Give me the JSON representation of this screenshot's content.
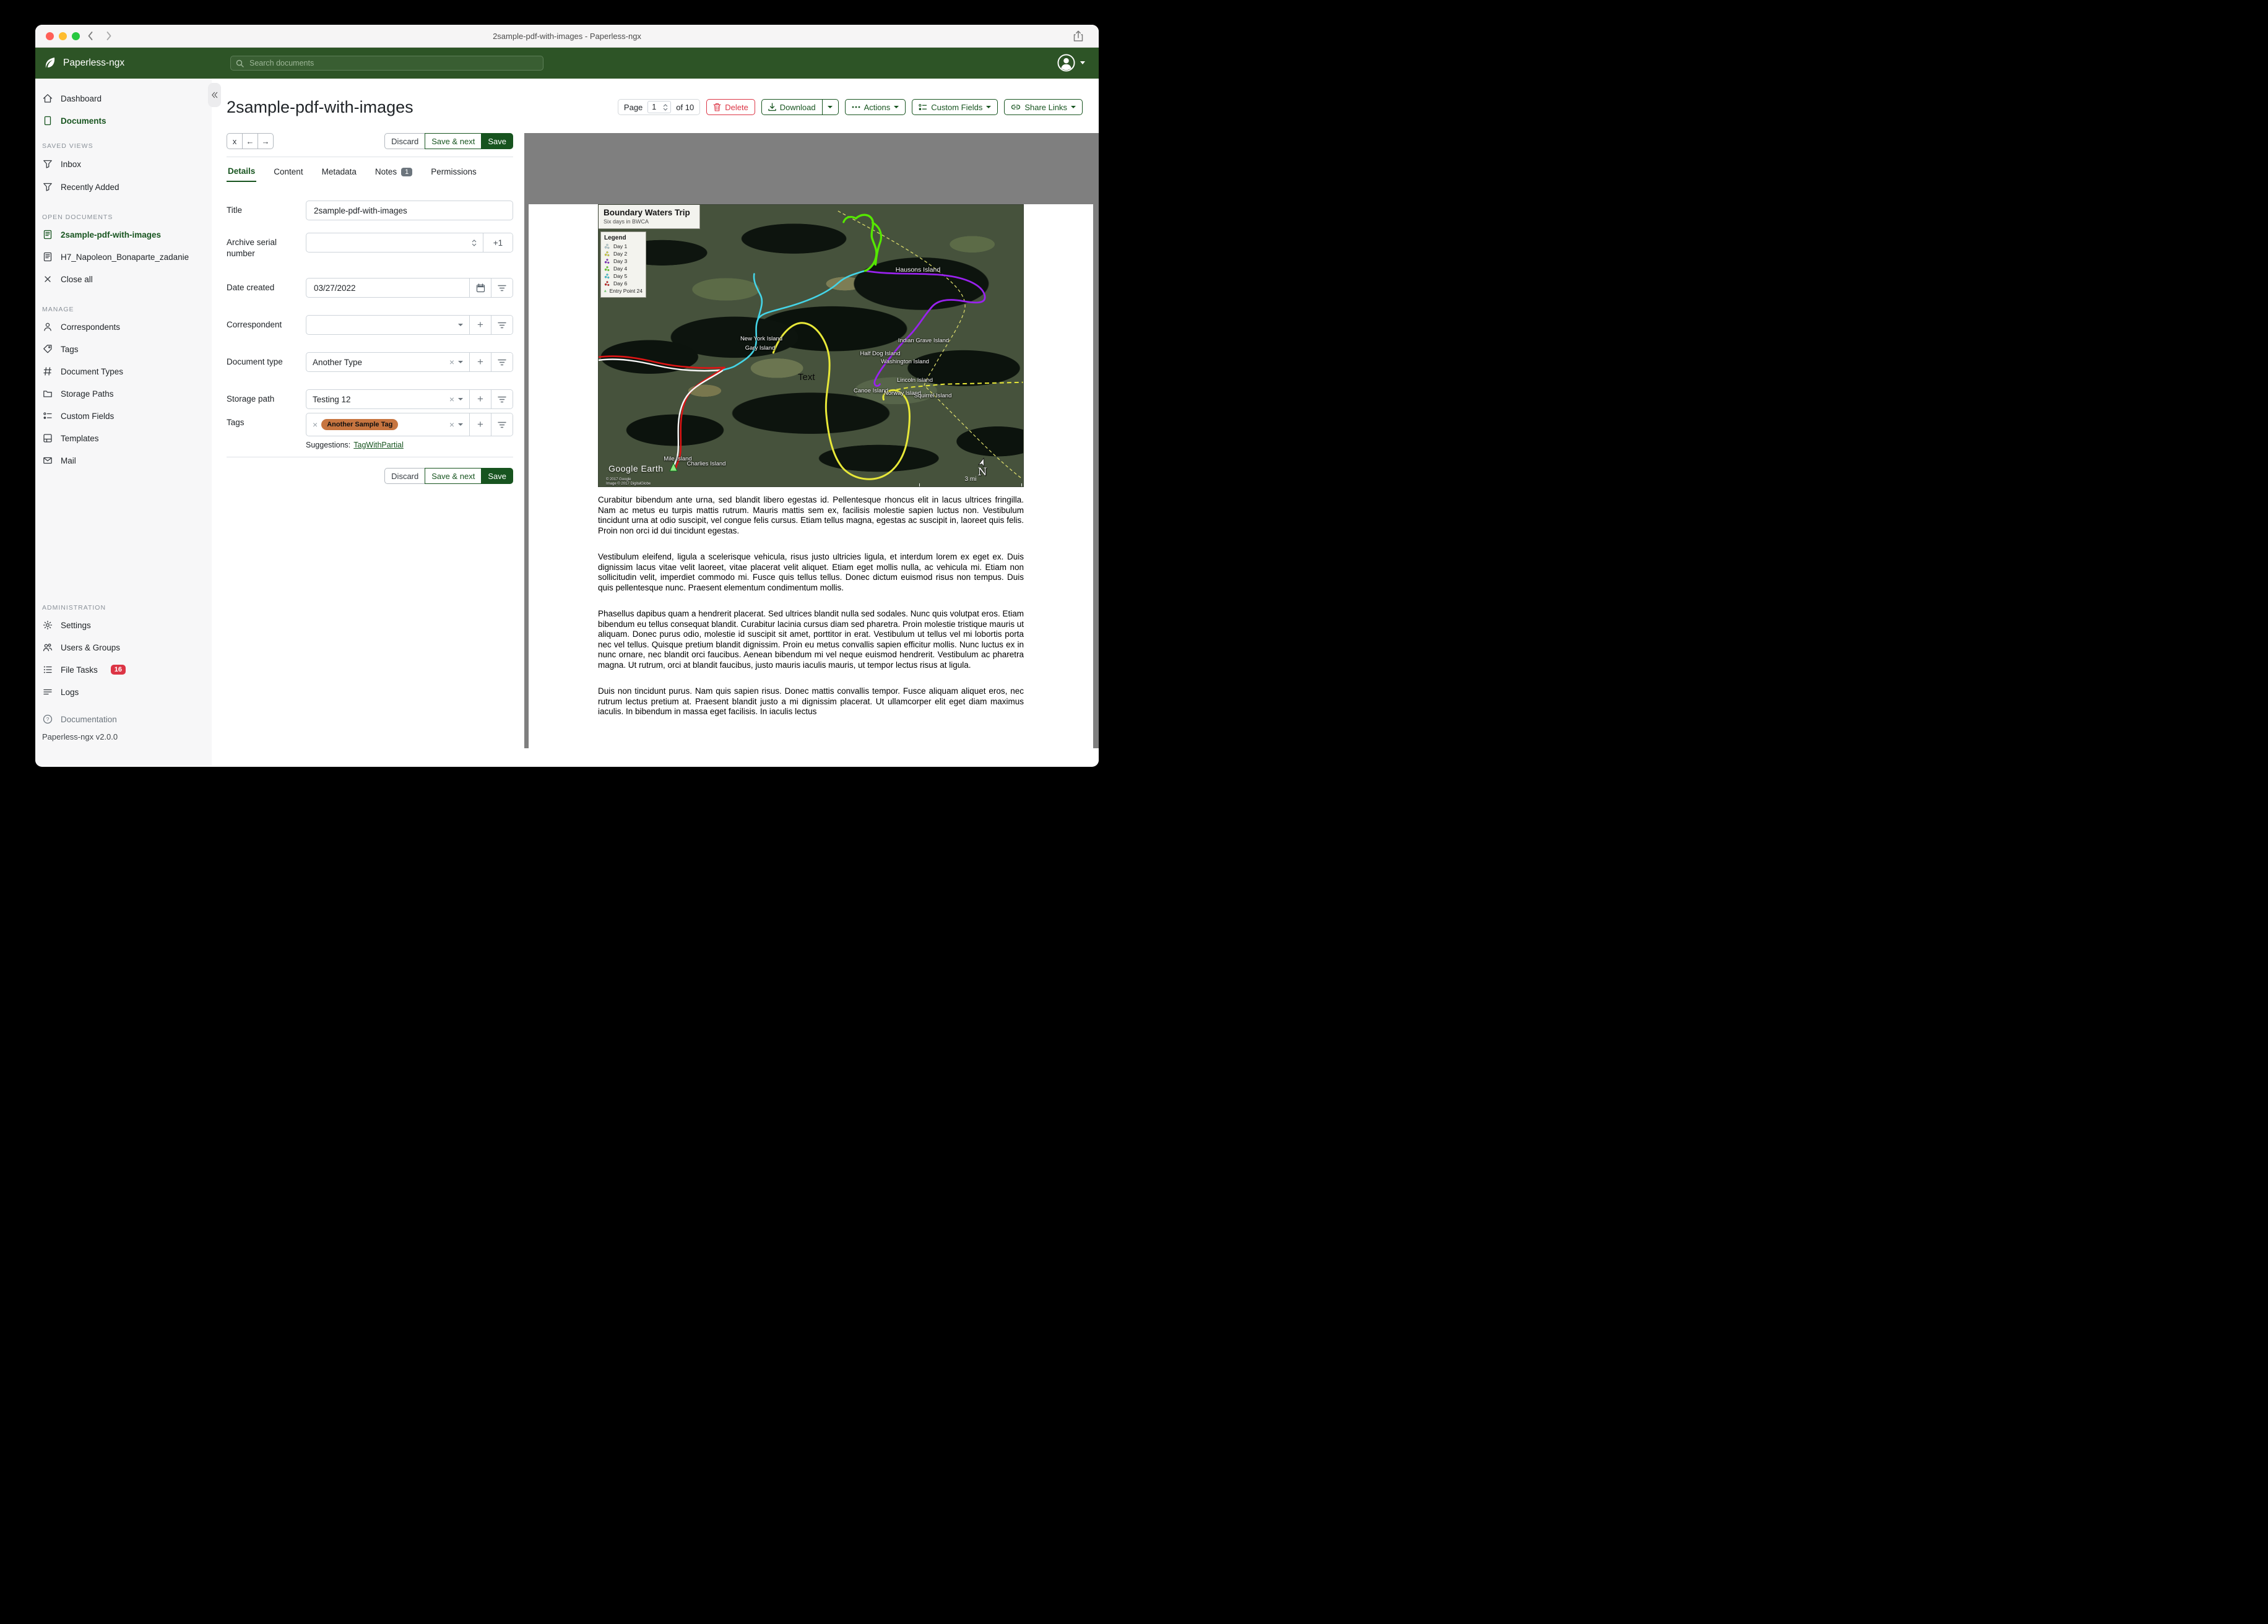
{
  "window": {
    "title": "2sample-pdf-with-images - Paperless-ngx"
  },
  "navbar": {
    "brand": "Paperless-ngx",
    "search_placeholder": "Search documents"
  },
  "sidebar": {
    "primary": [
      {
        "label": "Dashboard"
      },
      {
        "label": "Documents"
      }
    ],
    "saved_views": {
      "title": "SAVED VIEWS",
      "items": [
        {
          "label": "Inbox"
        },
        {
          "label": "Recently Added"
        }
      ]
    },
    "open_documents": {
      "title": "OPEN DOCUMENTS",
      "items": [
        {
          "label": "2sample-pdf-with-images"
        },
        {
          "label": "H7_Napoleon_Bonaparte_zadanie"
        },
        {
          "label": "Close all"
        }
      ]
    },
    "manage": {
      "title": "MANAGE",
      "items": [
        {
          "label": "Correspondents"
        },
        {
          "label": "Tags"
        },
        {
          "label": "Document Types"
        },
        {
          "label": "Storage Paths"
        },
        {
          "label": "Custom Fields"
        },
        {
          "label": "Templates"
        },
        {
          "label": "Mail"
        }
      ]
    },
    "administration": {
      "title": "ADMINISTRATION",
      "items": [
        {
          "label": "Settings"
        },
        {
          "label": "Users & Groups"
        },
        {
          "label": "File Tasks",
          "badge": "16"
        },
        {
          "label": "Logs"
        }
      ]
    },
    "documentation": "Documentation",
    "version": "Paperless-ngx v2.0.0"
  },
  "header": {
    "title": "2sample-pdf-with-images",
    "page": {
      "label": "Page",
      "value": "1",
      "total": "of 10"
    },
    "buttons": {
      "delete": "Delete",
      "download": "Download",
      "actions": "Actions",
      "custom_fields": "Custom Fields",
      "share_links": "Share Links"
    }
  },
  "toolbar": {
    "close": "x",
    "back": "←",
    "forward": "→",
    "discard": "Discard",
    "save_next": "Save & next",
    "save": "Save"
  },
  "tabs": [
    {
      "label": "Details"
    },
    {
      "label": "Content"
    },
    {
      "label": "Metadata"
    },
    {
      "label": "Notes",
      "badge": "1"
    },
    {
      "label": "Permissions"
    }
  ],
  "form": {
    "title": {
      "label": "Title",
      "value": "2sample-pdf-with-images"
    },
    "asn": {
      "label": "Archive serial number",
      "value": "",
      "plus_one": "+1"
    },
    "date_created": {
      "label": "Date created",
      "value": "03/27/2022"
    },
    "correspondent": {
      "label": "Correspondent",
      "value": ""
    },
    "document_type": {
      "label": "Document type",
      "value": "Another Type"
    },
    "storage_path": {
      "label": "Storage path",
      "value": "Testing 12"
    },
    "tags": {
      "label": "Tags",
      "chips": [
        {
          "label": "Another Sample Tag",
          "color": "#c77540"
        }
      ]
    },
    "suggestions": {
      "label": "Suggestions:",
      "links": [
        "TagWithPartial"
      ]
    }
  },
  "preview": {
    "map": {
      "title": "Boundary Waters Trip",
      "subtitle": "Six days in BWCA",
      "legend_title": "Legend",
      "legend": [
        {
          "label": "Day 1",
          "color": "#bcd8de"
        },
        {
          "label": "Day 2",
          "color": "#d9d945"
        },
        {
          "label": "Day 3",
          "color": "#8d35cf"
        },
        {
          "label": "Day 4",
          "color": "#6ade2d"
        },
        {
          "label": "Day 5",
          "color": "#3fd0df"
        },
        {
          "label": "Day 6",
          "color": "#cf2b2b"
        },
        {
          "label": "Entry Point 24",
          "color": "#8ee87f"
        }
      ],
      "labels": [
        "Hausons Island",
        "New York Island",
        "Gary Island",
        "Indian Grave Island",
        "Half Dog Island",
        "Washington Island",
        "Lincoln Island",
        "Canoe Island",
        "Norway Island",
        "Squirrel Island",
        "Mile Island",
        "Charlies Island"
      ],
      "text_annotation": "Text",
      "attribution": {
        "brand": "Google Earth",
        "line1": "© 2017 Google",
        "line2": "Image © 2017 DigitalGlobe"
      },
      "compass": "N",
      "scale": "3 mi"
    },
    "paragraphs": [
      "Curabitur bibendum ante urna, sed blandit libero egestas id. Pellentesque rhoncus elit in lacus ultrices fringilla. Nam ac metus eu turpis mattis rutrum. Mauris mattis sem ex, facilisis molestie sapien luctus non. Vestibulum tincidunt urna at odio suscipit, vel congue felis cursus. Etiam tellus magna, egestas ac suscipit in, laoreet quis felis. Proin non orci id dui tincidunt egestas.",
      "Vestibulum eleifend, ligula a scelerisque vehicula, risus justo ultricies ligula, et interdum lorem ex eget ex. Duis dignissim lacus vitae velit laoreet, vitae placerat velit aliquet. Etiam eget mollis nulla, ac vehicula mi. Etiam non sollicitudin velit, imperdiet commodo mi. Fusce quis tellus tellus. Donec dictum euismod risus non tempus. Duis quis pellentesque nunc. Praesent elementum condimentum mollis.",
      "Phasellus dapibus quam a hendrerit placerat. Sed ultrices blandit nulla sed sodales. Nunc quis volutpat eros. Etiam bibendum eu tellus consequat blandit. Curabitur lacinia cursus diam sed pharetra. Proin molestie tristique mauris ut aliquam. Donec purus odio, molestie id suscipit sit amet, porttitor in erat. Vestibulum ut tellus vel mi lobortis porta nec vel tellus. Quisque pretium blandit dignissim. Proin eu metus convallis sapien efficitur mollis. Nunc luctus ex in nunc ornare, nec blandit orci faucibus. Aenean bibendum mi vel neque euismod hendrerit. Vestibulum ac pharetra magna. Ut rutrum, orci at blandit faucibus, justo mauris iaculis mauris, ut tempor lectus risus at ligula.",
      "Duis non tincidunt purus. Nam quis sapien risus. Donec mattis convallis tempor. Fusce aliquam aliquet eros, nec rutrum lectus pretium at. Praesent blandit justo a mi dignissim placerat. Ut ullamcorper elit eget diam maximus iaculis. In bibendum in massa eget facilisis. In iaculis lectus"
    ]
  },
  "colors": {
    "accent_green": "#17541f",
    "navbar_green": "#2d5426",
    "danger_red": "#dc3545",
    "tag_orange": "#c77540",
    "badge_gray": "#6c757d",
    "file_tasks_badge_red": "#dc3545",
    "preview_background": "#7f7f7f"
  }
}
